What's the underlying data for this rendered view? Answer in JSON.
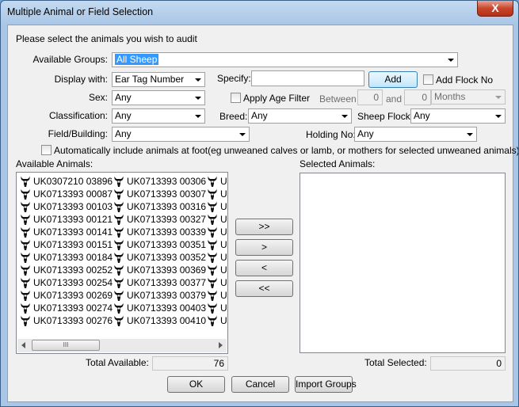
{
  "window": {
    "title": "Multiple Animal or Field Selection",
    "close_label": "X"
  },
  "prompt": "Please select the animals you wish to audit",
  "groups": {
    "label": "Available Groups:",
    "value": "All Sheep"
  },
  "display_with": {
    "label": "Display with:",
    "value": "Ear Tag Number"
  },
  "specify": {
    "label": "Specify:",
    "value": ""
  },
  "add_button": "Add",
  "add_flock_no": "Add Flock No",
  "sex": {
    "label": "Sex:",
    "value": "Any"
  },
  "age_filter": {
    "label": "Apply Age Filter",
    "between_label": "Between",
    "and_label": "and",
    "from": "0",
    "to": "0",
    "unit": "Months"
  },
  "classification": {
    "label": "Classification:",
    "value": "Any"
  },
  "breed": {
    "label": "Breed:",
    "value": "Any"
  },
  "sheep_flock": {
    "label": "Sheep Flock:",
    "value": "Any"
  },
  "field_building": {
    "label": "Field/Building:",
    "value": "Any"
  },
  "holding_no": {
    "label": "Holding No:",
    "value": "Any"
  },
  "auto_include": "Automatically include animals at foot(eg unweaned calves or lamb, or mothers for selected unweaned animals)",
  "available": {
    "label": "Available Animals:",
    "columns": [
      [
        "UK0307210 03896",
        "UK0713393 00087",
        "UK0713393 00103",
        "UK0713393 00121",
        "UK0713393 00141",
        "UK0713393 00151",
        "UK0713393 00184",
        "UK0713393 00252",
        "UK0713393 00254",
        "UK0713393 00269",
        "UK0713393 00274",
        "UK0713393 00276"
      ],
      [
        "UK0713393 00306",
        "UK0713393 00307",
        "UK0713393 00316",
        "UK0713393 00327",
        "UK0713393 00339",
        "UK0713393 00351",
        "UK0713393 00352",
        "UK0713393 00369",
        "UK0713393 00377",
        "UK0713393 00379",
        "UK0713393 00403",
        "UK0713393 00410"
      ],
      [
        "U",
        "U",
        "U",
        "U",
        "U",
        "U",
        "U",
        "U",
        "U",
        "U",
        "U",
        "U"
      ]
    ],
    "scroll_grip": "III",
    "total_label": "Total Available:",
    "total": "76"
  },
  "selected": {
    "label": "Selected Animals:",
    "total_label": "Total Selected:",
    "total": "0"
  },
  "transfer": {
    "add_all": ">>",
    "add_one": ">",
    "remove_one": "<",
    "remove_all": "<<"
  },
  "buttons": {
    "ok": "OK",
    "cancel": "Cancel",
    "import": "Import Groups"
  }
}
